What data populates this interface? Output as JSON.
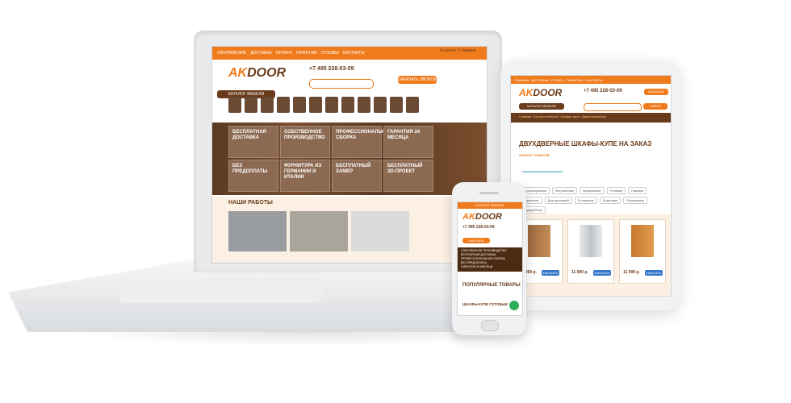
{
  "brand": {
    "logo_prefix": "AK",
    "logo_main": "DOOR"
  },
  "laptop": {
    "top_menu": [
      "ОФОРМЛЕНИЕ",
      "ДОСТАВКА",
      "ОПЛАТА",
      "ГАРАНТИИ",
      "ОТЗЫВЫ",
      "КОНТАКТЫ"
    ],
    "phone": "+7 495 228-03-09",
    "call_button": "ЗАКАЗАТЬ ЗВОНОК",
    "cart": "Корзина: 0 товаров",
    "catalog_button": "КАТАЛОГ МЕБЕЛИ",
    "tiles": [
      "БЕСПЛАТНАЯ ДОСТАВКА",
      "СОБСТВЕННОЕ ПРОИЗВОДСТВО",
      "ПРОФЕССИОНАЛЬНАЯ СБОРКА",
      "ГАРАНТИЯ 24 МЕСЯЦА",
      "БЕЗ ПРЕДОПЛАТЫ",
      "ФУРНИТУРА ИЗ ГЕРМАНИИ И ИТАЛИИ",
      "БЕСПЛАТНЫЙ ЗАМЕР",
      "БЕСПЛАТНЫЙ 3D-ПРОЕКТ"
    ],
    "works_title": "НАШИ РАБОТЫ"
  },
  "tablet": {
    "top_menu": [
      "ГЛАВНАЯ",
      "ДОСТАВКА",
      "ОПЛАТА",
      "ГАРАНТИИ",
      "КОНТАКТЫ"
    ],
    "phone": "+7 495 228-03-09",
    "call_button": "ЗАКАЗАТЬ ЗВОНОК",
    "catalog_button": "КАТАЛОГ МЕБЕЛИ",
    "search_button": "НАЙТИ",
    "breadcrumbs": "Главная / Каталог мебели / Шкафы-купе / Двухстворчатые",
    "page_title": "ДВУХДВЕРНЫЕ ШКАФЫ-КУПЕ НА ЗАКАЗ",
    "filter_label": "ФИЛЬТР ТОВАРОВ",
    "tags": [
      "Двухстворчатые",
      "Встроенные",
      "Зеркальные",
      "Угловые",
      "Прямые",
      "Радиусные",
      "Для прихожей",
      "В спальню",
      "В детскую",
      "Распашные",
      "Гардеробные"
    ],
    "products": [
      {
        "price": "11 990 р.",
        "cta": "ЗАКАЗАТЬ"
      },
      {
        "price": "11 990 р.",
        "cta": "ЗАКАЗАТЬ"
      },
      {
        "price": "11 990 р.",
        "cta": "ЗАКАЗАТЬ"
      }
    ]
  },
  "phone": {
    "top_bar": "КАТАЛОГ МЕБЕЛИ",
    "phone": "+7 495 228-03-09",
    "call_button": "ЗАКАЗАТЬ ЗВОНОК",
    "benefits": [
      "СОБСТВЕННОЕ ПРОИЗВОДСТВО",
      "БЕСПЛАТНАЯ ДОСТАВКА",
      "ПРОФЕССИОНАЛЬНАЯ СБОРКА",
      "БЕЗ ПРЕДОПЛАТЫ",
      "ГАРАНТИЯ 24 МЕСЯЦА"
    ],
    "popular_title": "ПОПУЛЯРНЫЕ ТОВАРЫ",
    "category_title": "ШКАФЫ-КУПЕ ГОТОВЫЕ"
  },
  "colors": {
    "accent": "#f07b1c",
    "brown": "#6a3b1a",
    "cta_blue": "#2f72c7",
    "chat_green": "#2fae5a"
  }
}
